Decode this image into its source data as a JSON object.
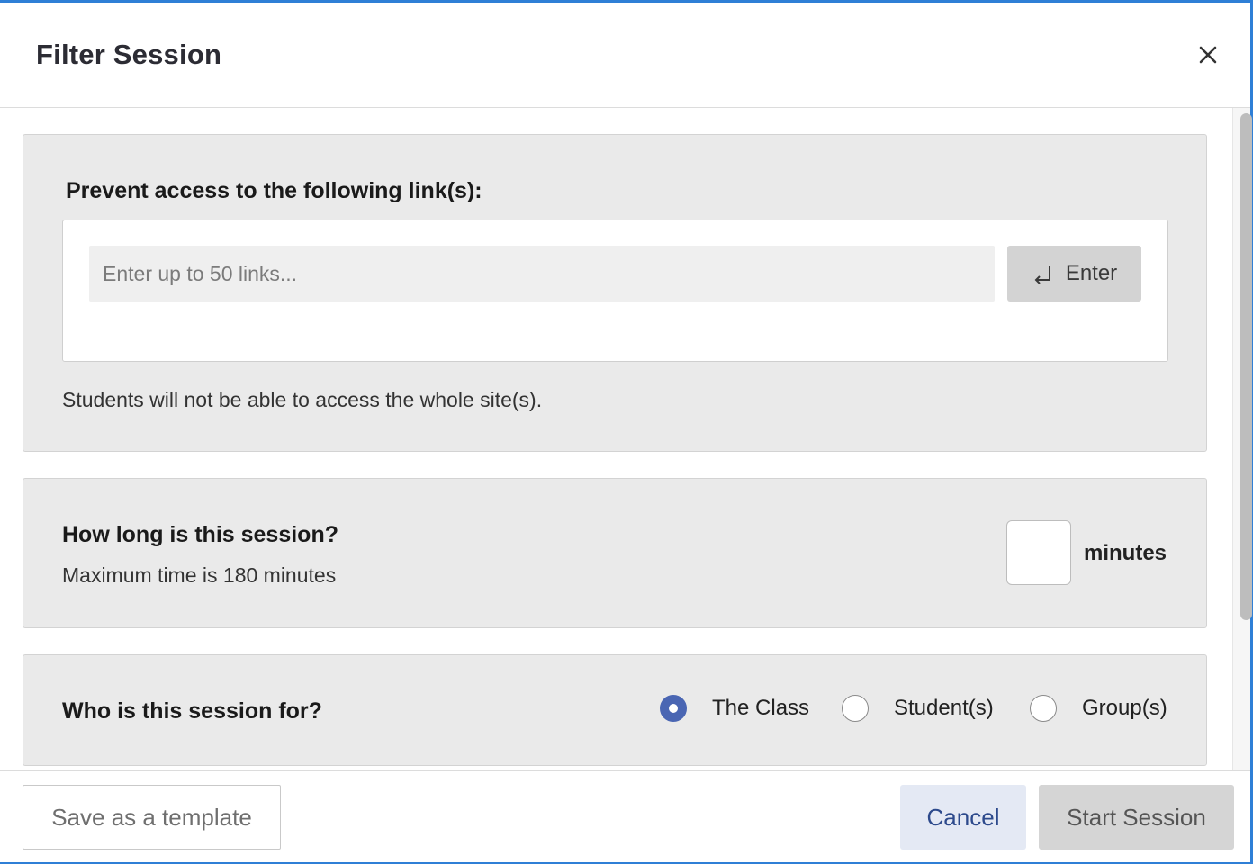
{
  "dialog": {
    "title": "Filter Session"
  },
  "links_section": {
    "heading": "Prevent access to the following link(s):",
    "input_placeholder": "Enter up to 50 links...",
    "input_value": "",
    "enter_label": "Enter",
    "note": "Students will not be able to access the whole site(s)."
  },
  "duration_section": {
    "heading": "How long is this session?",
    "subtext": "Maximum time is 180 minutes",
    "minutes_value": "",
    "unit_label": "minutes"
  },
  "audience_section": {
    "heading": "Who is this session for?",
    "options": [
      {
        "label": "The Class",
        "selected": true
      },
      {
        "label": "Student(s)",
        "selected": false
      },
      {
        "label": "Group(s)",
        "selected": false
      }
    ]
  },
  "footer": {
    "save_template_label": "Save as a template",
    "cancel_label": "Cancel",
    "start_label": "Start Session"
  },
  "colors": {
    "accent": "#2f7fd6",
    "radio_selected": "#4a66b3",
    "cancel_text": "#2d4a8c",
    "panel_bg": "#eaeaea"
  },
  "icons": {
    "close": "close-icon",
    "enter": "enter-return-icon"
  }
}
